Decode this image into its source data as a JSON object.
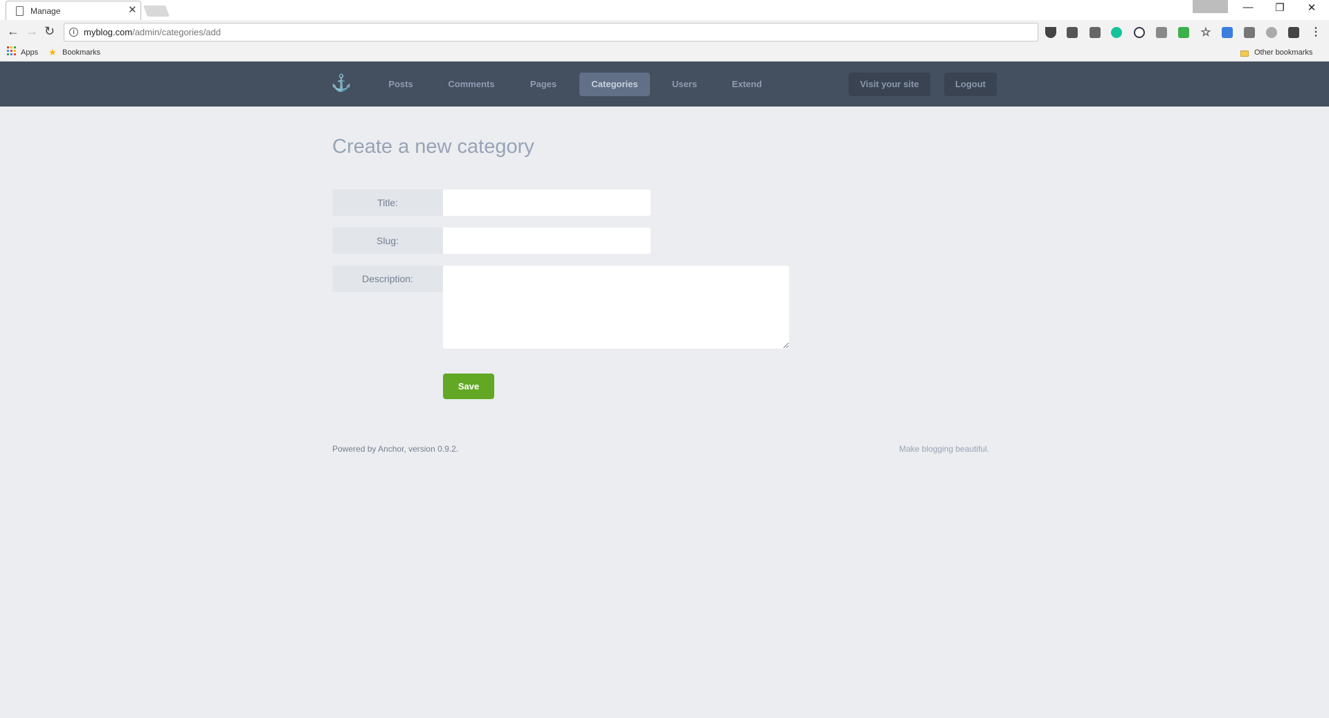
{
  "browser": {
    "tab_title": "Manage",
    "tab_close": "✕",
    "url_host": "myblog.com",
    "url_path": "/admin/categories/add",
    "bookmarks": {
      "apps_label": "Apps",
      "bookmarks_label": "Bookmarks",
      "other_label": "Other bookmarks"
    },
    "window_controls": {
      "minimize": "—",
      "restore": "❐",
      "close": "✕"
    }
  },
  "nav": {
    "items": [
      {
        "label": "Posts"
      },
      {
        "label": "Comments"
      },
      {
        "label": "Pages"
      },
      {
        "label": "Categories",
        "active": true
      },
      {
        "label": "Users"
      },
      {
        "label": "Extend"
      }
    ],
    "visit_site_label": "Visit your site",
    "logout_label": "Logout"
  },
  "page": {
    "title": "Create a new category",
    "form": {
      "title_label": "Title:",
      "title_value": "",
      "slug_label": "Slug:",
      "slug_value": "",
      "description_label": "Description:",
      "description_value": "",
      "save_label": "Save"
    }
  },
  "footer": {
    "left": "Powered by Anchor, version 0.9.2.",
    "right": "Make blogging beautiful."
  },
  "colors": {
    "header_bg": "#444f5f",
    "page_bg": "#ecedf0",
    "active_nav": "#627087",
    "save_green": "#62a825"
  }
}
